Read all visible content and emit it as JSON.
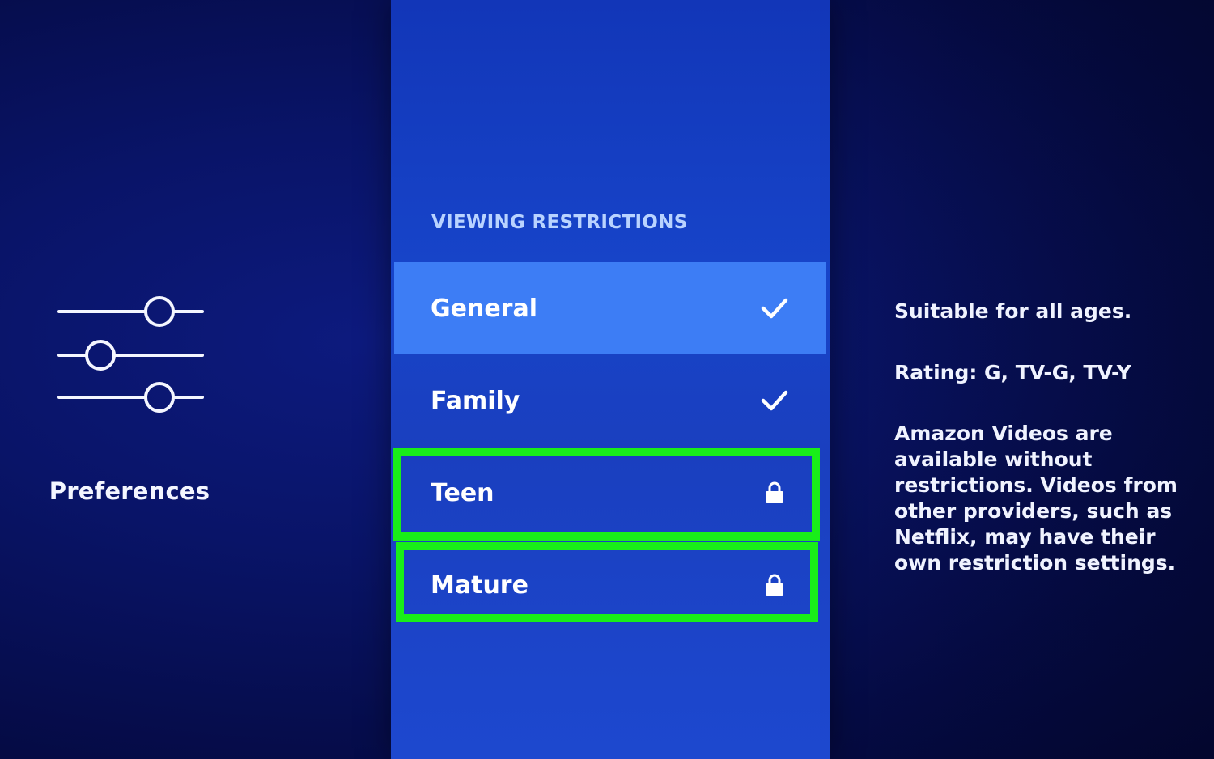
{
  "left_section": {
    "title": "Preferences",
    "icon": "sliders-icon"
  },
  "menu": {
    "header": "VIEWING RESTRICTIONS",
    "items": [
      {
        "label": "General",
        "status_icon": "checkmark-icon",
        "selected": true
      },
      {
        "label": "Family",
        "status_icon": "checkmark-icon",
        "selected": false
      },
      {
        "label": "Teen",
        "status_icon": "lock-icon",
        "selected": false
      },
      {
        "label": "Mature",
        "status_icon": "lock-icon",
        "selected": false
      }
    ]
  },
  "info": {
    "suitability": "Suitable for all ages.",
    "rating": "Rating: G, TV-G, TV-Y",
    "description": "Amazon Videos are available without restrictions. Videos from other providers, such as Netflix, may have their own restriction settings."
  },
  "colors": {
    "background": "#060b3f",
    "panel": "#1744c9",
    "selected_item": "#3d7df5",
    "header_text": "#b9d3ff",
    "highlight_annotation": "#19ee19"
  }
}
